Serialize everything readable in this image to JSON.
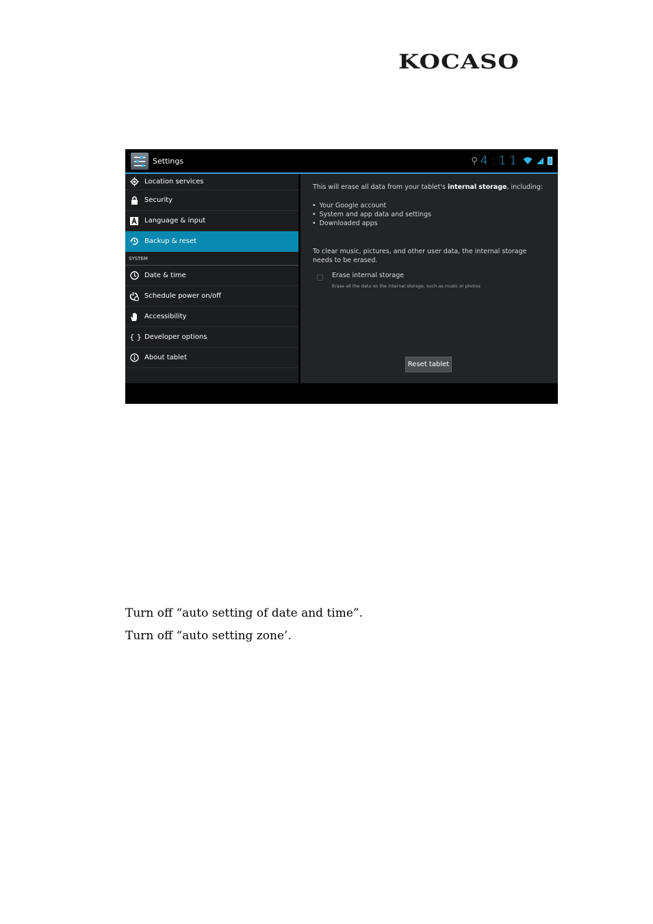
{
  "logo": {
    "text": "KOCASO"
  },
  "screenshot": {
    "action_bar": {
      "title": "Settings",
      "clock": "4:11"
    },
    "menu": [
      {
        "label": "Location services",
        "icon": "location-icon"
      },
      {
        "label": "Security",
        "icon": "lock-icon"
      },
      {
        "label": "Language & input",
        "icon": "language-icon"
      },
      {
        "label": "Backup & reset",
        "icon": "backup-icon",
        "active": true
      }
    ],
    "section_header": "SYSTEM",
    "system_menu": [
      {
        "label": "Date & time",
        "icon": "clock-icon"
      },
      {
        "label": "Schedule power on/off",
        "icon": "schedule-power-icon"
      },
      {
        "label": "Accessibility",
        "icon": "hand-icon"
      },
      {
        "label": "Developer options",
        "icon": "braces-icon"
      },
      {
        "label": "About tablet",
        "icon": "info-icon"
      }
    ],
    "detail": {
      "intro_prefix": "This will erase all data from your tablet's ",
      "intro_bold": "internal storage",
      "intro_suffix": ", including:",
      "bullets": [
        "Your Google account",
        "System and app data and settings",
        "Downloaded apps"
      ],
      "clear_line1": "To clear music, pictures, and other user data, the internal storage",
      "clear_line2": "needs to be erased.",
      "checkbox_title": "Erase internal storage",
      "checkbox_summary": "Erase all the data on the internal storage, such as music or photos",
      "checkbox_checked": false,
      "reset_button": "Reset tablet"
    },
    "accent_color": "#33b5e5",
    "selected_color": "#0a89b0"
  },
  "captions": [
    "Turn off “auto setting of date and time”.",
    "Turn off “auto setting zone’."
  ]
}
